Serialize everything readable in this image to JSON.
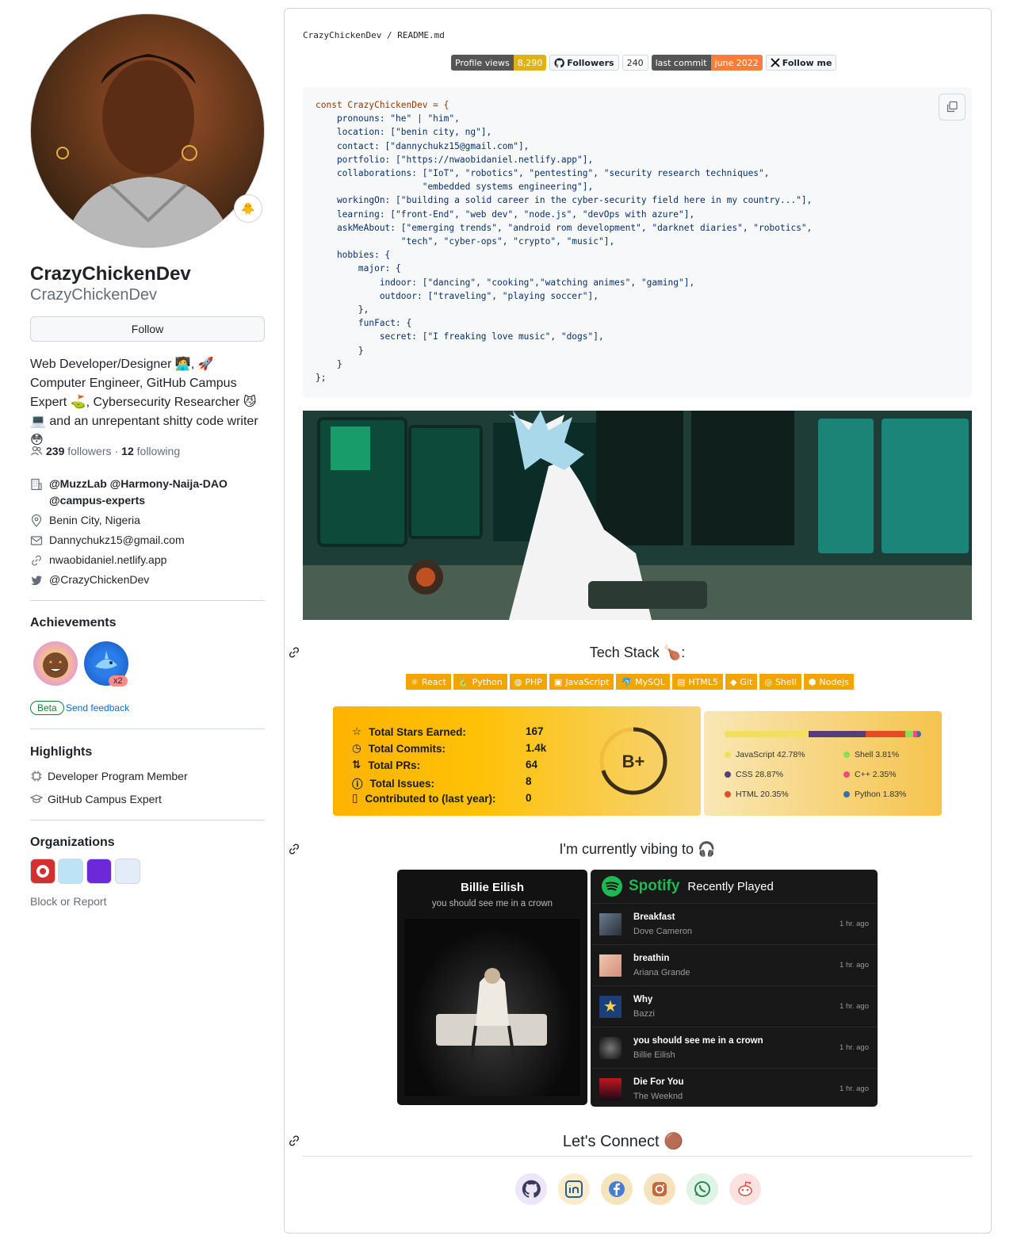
{
  "profile": {
    "name": "CrazyChickenDev",
    "login": "CrazyChickenDev",
    "follow_label": "Follow",
    "bio": "Web Developer/Designer 🧑‍💻, 🚀 Computer Engineer, GitHub Campus Expert ⛳, Cybersecurity Researcher 😼 💻 and an unrepentant shitty code writer 😳",
    "followers_count": "239",
    "followers_label": "followers",
    "dot": "·",
    "following_count": "12",
    "following_label": "following",
    "orgs_text": "@MuzzLab @Harmony-Naija-DAO @campus-experts",
    "location": "Benin City, Nigeria",
    "email": "Dannychukz15@gmail.com",
    "website": "nwaobidaniel.netlify.app",
    "twitter": "@CrazyChickenDev",
    "achievements_title": "Achievements",
    "achievement_multiplier": "x2",
    "beta_label": "Beta",
    "feedback_label": "Send feedback",
    "highlights_title": "Highlights",
    "highlights": [
      "Developer Program Member",
      "GitHub Campus Expert"
    ],
    "organizations_title": "Organizations",
    "block_label": "Block or Report"
  },
  "readme": {
    "path_user": "CrazyChickenDev",
    "path_sep": "/",
    "path_file": "README.md",
    "badges": [
      {
        "label": "Profile views",
        "value": "8,290"
      },
      {
        "label": "Followers",
        "value": "240"
      },
      {
        "label": "last commit",
        "value": "june 2022"
      },
      {
        "label": "Follow me"
      }
    ],
    "code_lines": [
      "const CrazyChickenDev = {",
      "    pronouns: \"he\" | \"him\",",
      "    location: [\"benin city, ng\"],",
      "    contact: [\"dannychukz15@gmail.com\"],",
      "    portfolio: [\"https://nwaobidaniel.netlify.app\"],",
      "    collaborations: [\"IoT\", \"robotics\", \"pentesting\", \"security research techniques\",",
      "                    \"embedded systems engineering\"],",
      "    workingOn: [\"building a solid career in the cyber-security field here in my country...\"],",
      "    learning: [\"front-End\", \"web dev\", \"node.js\", \"devOps with azure\"],",
      "    askMeAbout: [\"emerging trends\", \"android rom development\", \"darknet diaries\", \"robotics\",",
      "                \"tech\", \"cyber-ops\", \"crypto\", \"music\"],",
      "    hobbies: {",
      "        major: {",
      "            indoor: [\"dancing\", \"cooking\",\"watching animes\", \"gaming\"],",
      "            outdoor: [\"traveling\", \"playing soccer\"],",
      "        },",
      "        funFact: {",
      "            secret: [\"I freaking love music\", \"dogs\"],",
      "        }",
      "    }",
      "};"
    ],
    "tech_title": "Tech Stack 🍗:",
    "tech": [
      "React",
      "Python",
      "PHP",
      "JavaScript",
      "MySQL",
      "HTML5",
      "Git",
      "Shell",
      "Nodejs"
    ],
    "stats": {
      "rows": [
        {
          "label": "Total Stars Earned:",
          "value": "167"
        },
        {
          "label": "Total Commits:",
          "value": "1.4k"
        },
        {
          "label": "Total PRs:",
          "value": "64"
        },
        {
          "label": "Total Issues:",
          "value": "8"
        },
        {
          "label": "Contributed to (last year):",
          "value": "0"
        }
      ],
      "grade": "B+",
      "grade_fraction": 0.7
    },
    "languages": [
      {
        "name": "JavaScript",
        "percent": 42.78,
        "label": "JavaScript 42.78%",
        "color": "#f1e05a"
      },
      {
        "name": "CSS",
        "percent": 28.87,
        "label": "CSS 28.87%",
        "color": "#563d7c"
      },
      {
        "name": "HTML",
        "percent": 20.35,
        "label": "HTML 20.35%",
        "color": "#e34c26"
      },
      {
        "name": "Shell",
        "percent": 3.81,
        "label": "Shell 3.81%",
        "color": "#89e051"
      },
      {
        "name": "C++",
        "percent": 2.35,
        "label": "C++ 2.35%",
        "color": "#f34b7d"
      },
      {
        "name": "Python",
        "percent": 1.83,
        "label": "Python 1.83%",
        "color": "#3572A5"
      }
    ],
    "vibing_title": "I'm currently vibing to 🎧",
    "now_playing": {
      "artist": "Billie Eilish",
      "song": "you should see me in a crown"
    },
    "spotify": {
      "brand": "Spotify",
      "title": "Recently Played",
      "tracks": [
        {
          "title": "Breakfast",
          "artist": "Dove Cameron",
          "ago": "1 hr. ago"
        },
        {
          "title": "breathin",
          "artist": "Ariana Grande",
          "ago": "1 hr. ago"
        },
        {
          "title": "Why",
          "artist": "Bazzi",
          "ago": "1 hr. ago"
        },
        {
          "title": "you should see me in a crown",
          "artist": "Billie Eilish",
          "ago": "1 hr. ago"
        },
        {
          "title": "Die For You",
          "artist": "The Weeknd",
          "ago": "1 hr. ago"
        }
      ]
    },
    "connect_title": "Let's Connect 🟤",
    "social": [
      "github",
      "linkedin",
      "facebook",
      "instagram",
      "whatsapp",
      "reddit"
    ]
  }
}
